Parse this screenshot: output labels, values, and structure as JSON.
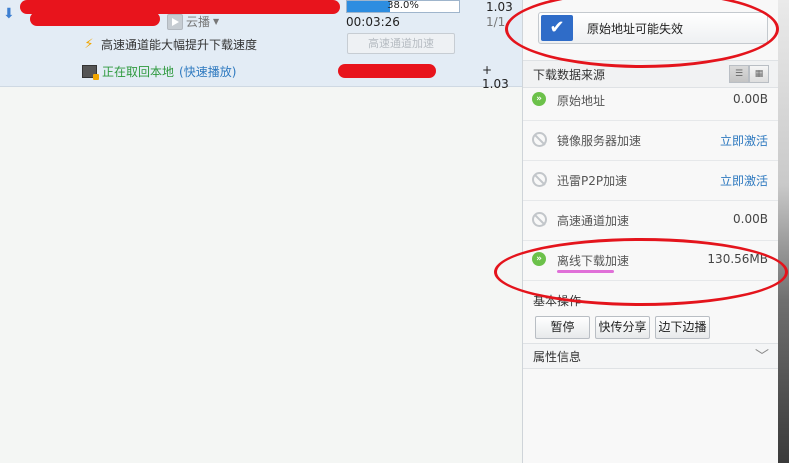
{
  "task": {
    "cloud_play_label": "云播",
    "progress": {
      "fraction": 0.38,
      "label": "38.0%"
    },
    "elapsed": "00:03:26",
    "size_partial": "1.03",
    "count_partial": "1/1",
    "speed_tip": "高速通道能大幅提升下载速度",
    "speed_button": "高速通道加速",
    "local_text": "正在取回本地",
    "local_link": "(快速播放)",
    "plus_size": "+ 1.03"
  },
  "panel": {
    "warning_text": "原始地址可能失效",
    "sources_title": "下载数据来源",
    "sources": [
      {
        "name": "原始地址",
        "value": "0.00B",
        "status": "active"
      },
      {
        "name": "镜像服务器加速",
        "value": "立即激活",
        "status": "inactive"
      },
      {
        "name": "迅雷P2P加速",
        "value": "立即激活",
        "status": "inactive"
      },
      {
        "name": "高速通道加速",
        "value": "0.00B",
        "status": "inactive"
      },
      {
        "name": "离线下载加速",
        "value": "130.56MB",
        "status": "active"
      }
    ],
    "ops_title": "基本操作",
    "ops": [
      "暂停",
      "快传分享",
      "边下边播"
    ],
    "props_title": "属性信息"
  },
  "colors": {
    "accent_blue": "#2f6cc8",
    "link": "#2f7ac0",
    "active_green": "#6cc14a",
    "annotation_red": "#e4141c",
    "highlight_pink": "#e070d8"
  }
}
